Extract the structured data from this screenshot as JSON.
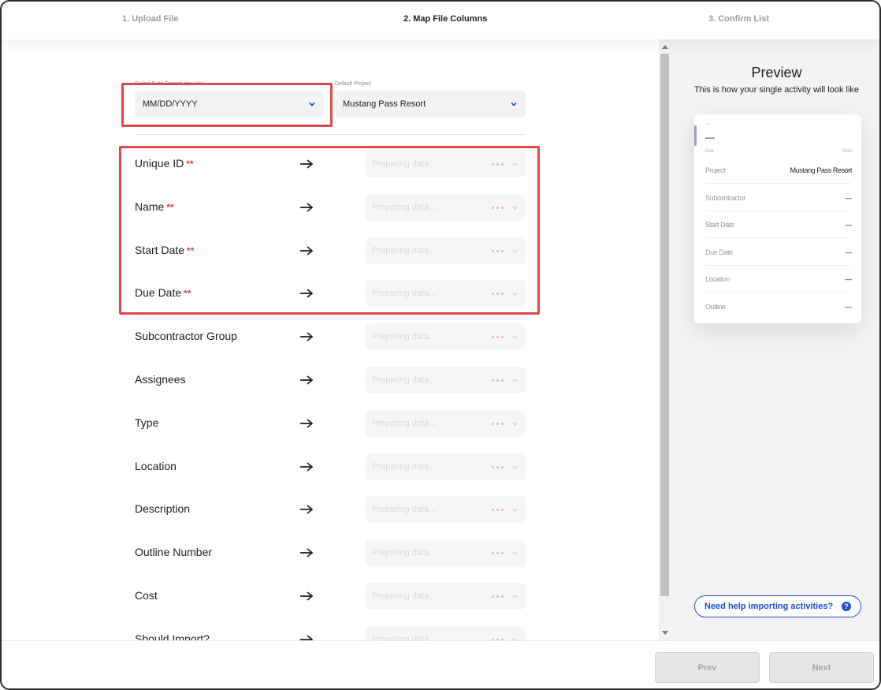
{
  "stepper": {
    "steps": [
      {
        "label": "1. Upload File",
        "state": "inactive"
      },
      {
        "label": "2. Map File Columns",
        "state": "active"
      },
      {
        "label": "3. Confirm List",
        "state": "inactive"
      }
    ]
  },
  "settings": {
    "date_format_label": "Select Date Format You Use",
    "date_format_value": "MM/DD/YYYY",
    "project_label": "Default Project",
    "project_value": "Mustang Pass Resort"
  },
  "mapping": {
    "placeholder": "Preparing data...",
    "required_marker": "**",
    "rows": [
      {
        "label": "Unique ID",
        "required": true
      },
      {
        "label": "Name",
        "required": true
      },
      {
        "label": "Start Date",
        "required": true
      },
      {
        "label": "Due Date",
        "required": true
      },
      {
        "label": "Subcontractor Group",
        "required": false
      },
      {
        "label": "Assignees",
        "required": false
      },
      {
        "label": "Type",
        "required": false
      },
      {
        "label": "Location",
        "required": false
      },
      {
        "label": "Description",
        "required": false
      },
      {
        "label": "Outline Number",
        "required": false
      },
      {
        "label": "Cost",
        "required": false
      },
      {
        "label": "Should Import?",
        "required": false
      }
    ]
  },
  "preview": {
    "title": "Preview",
    "subtitle": "This is how your single activity will look like",
    "card": {
      "top_small": "—",
      "top_value": "—",
      "due_label": "Due",
      "start_label": "Start",
      "fields": [
        {
          "key": "Project",
          "value": "Mustang Pass Resort"
        },
        {
          "key": "Subcontractor",
          "value": "—"
        },
        {
          "key": "Start Date",
          "value": "—"
        },
        {
          "key": "Due Date",
          "value": "—"
        },
        {
          "key": "Location",
          "value": "—"
        },
        {
          "key": "Outline",
          "value": "—"
        }
      ]
    },
    "help_button": "Need help importing activities?",
    "help_icon": "?"
  },
  "footer": {
    "prev_label": "Prev",
    "next_label": "Next"
  },
  "colors": {
    "highlight": "#e14848",
    "required": "#e0443a",
    "link_blue": "#1a4fd6"
  }
}
